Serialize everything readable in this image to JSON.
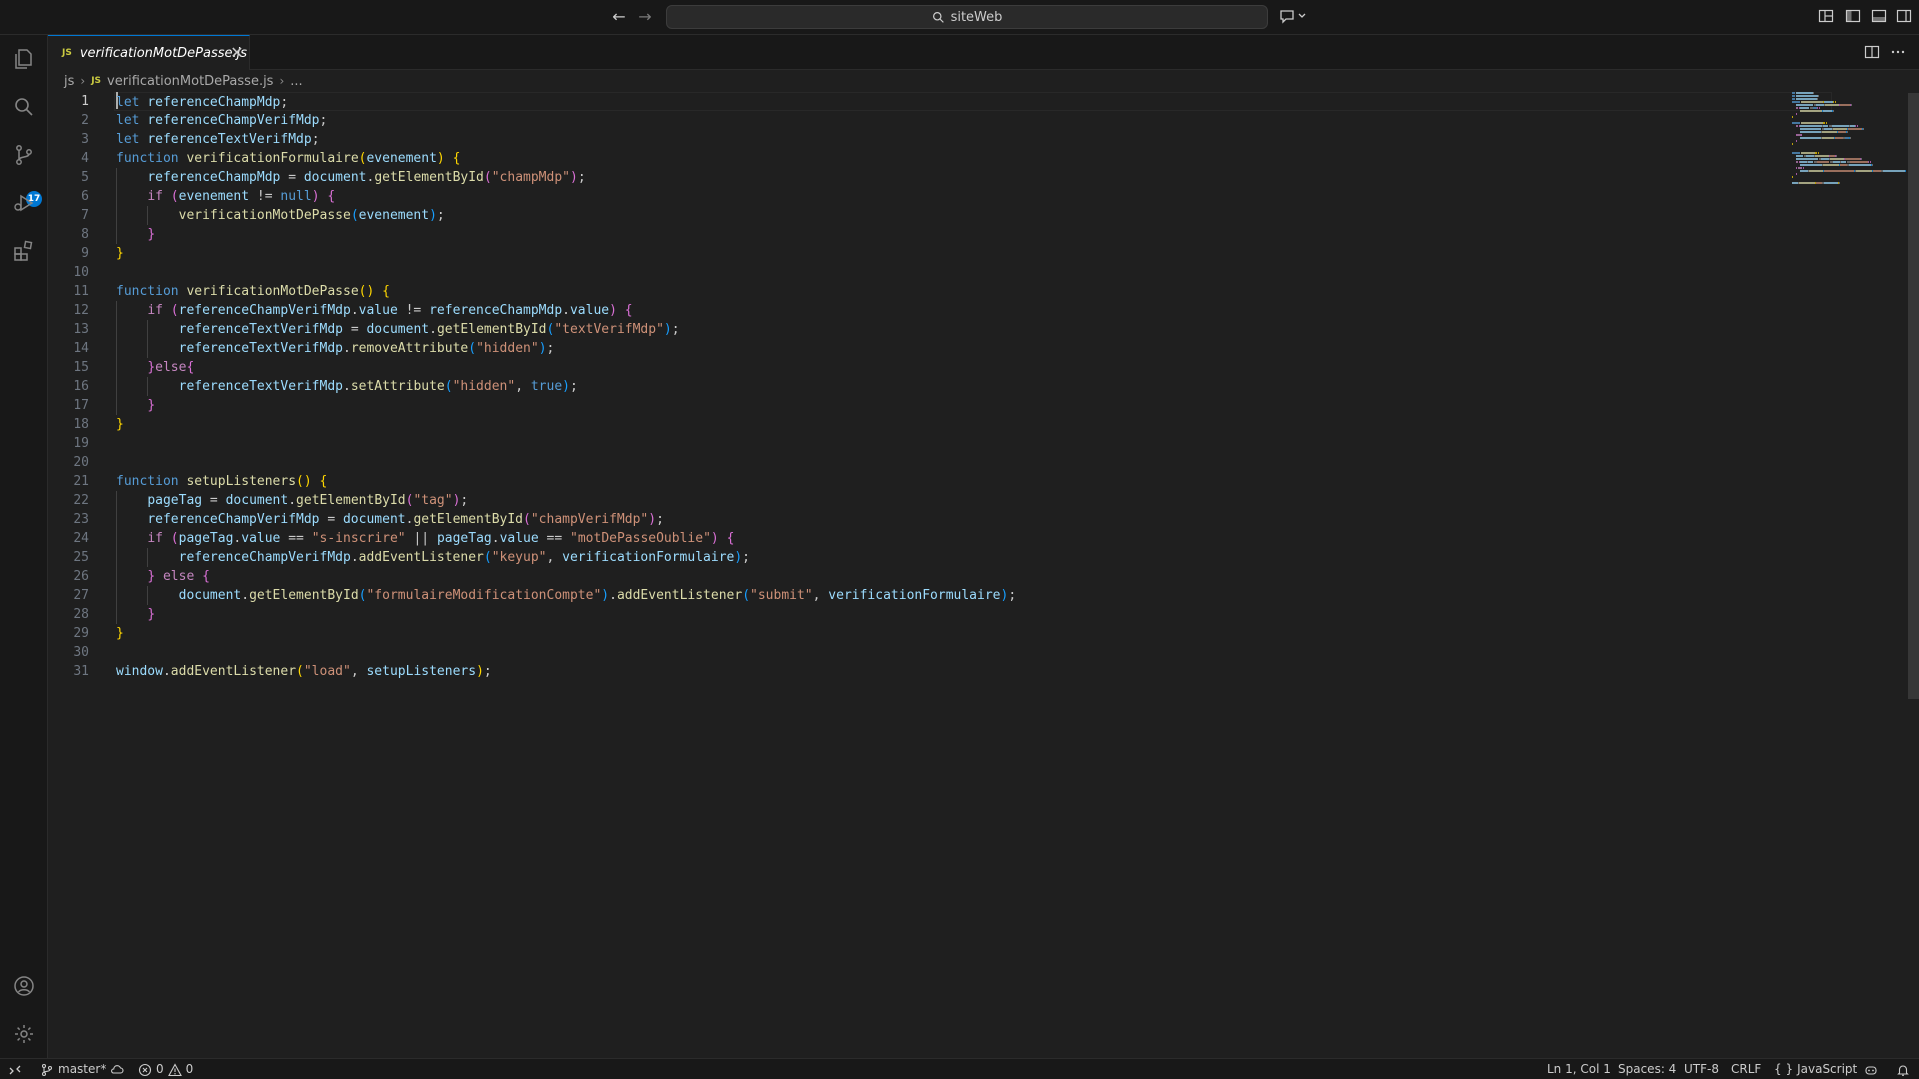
{
  "window": {
    "search_text": "siteWeb",
    "nav_back": "←",
    "nav_forward": "→"
  },
  "tab": {
    "icon_text": "JS",
    "label": "verificationMotDePasse.js",
    "close": "✕"
  },
  "breadcrumb": {
    "folder": "js",
    "file_icon_text": "JS",
    "file": "verificationMotDePasse.js",
    "symbol": "..."
  },
  "activity": {
    "scm_badge": "17"
  },
  "editor": {
    "line_numbers": [
      "1",
      "2",
      "3",
      "4",
      "5",
      "6",
      "7",
      "8",
      "9",
      "10",
      "11",
      "12",
      "13",
      "14",
      "15",
      "16",
      "17",
      "18",
      "19",
      "20",
      "21",
      "22",
      "23",
      "24",
      "25",
      "26",
      "27",
      "28",
      "29",
      "30",
      "31"
    ],
    "active_line": 1,
    "lines": [
      [
        [
          "kw",
          "let"
        ],
        [
          "pn",
          " "
        ],
        [
          "var",
          "referenceChampMdp"
        ],
        [
          "pn",
          ";"
        ]
      ],
      [
        [
          "kw",
          "let"
        ],
        [
          "pn",
          " "
        ],
        [
          "var",
          "referenceChampVerifMdp"
        ],
        [
          "pn",
          ";"
        ]
      ],
      [
        [
          "kw",
          "let"
        ],
        [
          "pn",
          " "
        ],
        [
          "var",
          "referenceTextVerifMdp"
        ],
        [
          "pn",
          ";"
        ]
      ],
      [
        [
          "kw",
          "function"
        ],
        [
          "pn",
          " "
        ],
        [
          "fn",
          "verificationFormulaire"
        ],
        [
          "b1",
          "("
        ],
        [
          "var",
          "evenement"
        ],
        [
          "b1",
          ")"
        ],
        [
          "pn",
          " "
        ],
        [
          "b1",
          "{"
        ]
      ],
      [
        [
          "pn",
          "    "
        ],
        [
          "var",
          "referenceChampMdp"
        ],
        [
          "pn",
          " = "
        ],
        [
          "var",
          "document"
        ],
        [
          "pn",
          "."
        ],
        [
          "fn",
          "getElementById"
        ],
        [
          "b2",
          "("
        ],
        [
          "str",
          "\"champMdp\""
        ],
        [
          "b2",
          ")"
        ],
        [
          "pn",
          ";"
        ]
      ],
      [
        [
          "pn",
          "    "
        ],
        [
          "ctrl",
          "if"
        ],
        [
          "pn",
          " "
        ],
        [
          "b2",
          "("
        ],
        [
          "var",
          "evenement"
        ],
        [
          "pn",
          " != "
        ],
        [
          "kw",
          "null"
        ],
        [
          "b2",
          ")"
        ],
        [
          "pn",
          " "
        ],
        [
          "b2",
          "{"
        ]
      ],
      [
        [
          "pn",
          "        "
        ],
        [
          "fn",
          "verificationMotDePasse"
        ],
        [
          "b3",
          "("
        ],
        [
          "var",
          "evenement"
        ],
        [
          "b3",
          ")"
        ],
        [
          "pn",
          ";"
        ]
      ],
      [
        [
          "pn",
          "    "
        ],
        [
          "b2",
          "}"
        ]
      ],
      [
        [
          "b1",
          "}"
        ]
      ],
      [],
      [
        [
          "kw",
          "function"
        ],
        [
          "pn",
          " "
        ],
        [
          "fn",
          "verificationMotDePasse"
        ],
        [
          "b1",
          "()"
        ],
        [
          "pn",
          " "
        ],
        [
          "b1",
          "{"
        ]
      ],
      [
        [
          "pn",
          "    "
        ],
        [
          "ctrl",
          "if"
        ],
        [
          "pn",
          " "
        ],
        [
          "b2",
          "("
        ],
        [
          "var",
          "referenceChampVerifMdp"
        ],
        [
          "pn",
          "."
        ],
        [
          "var",
          "value"
        ],
        [
          "pn",
          " != "
        ],
        [
          "var",
          "referenceChampMdp"
        ],
        [
          "pn",
          "."
        ],
        [
          "var",
          "value"
        ],
        [
          "b2",
          ")"
        ],
        [
          "pn",
          " "
        ],
        [
          "b2",
          "{"
        ]
      ],
      [
        [
          "pn",
          "        "
        ],
        [
          "var",
          "referenceTextVerifMdp"
        ],
        [
          "pn",
          " = "
        ],
        [
          "var",
          "document"
        ],
        [
          "pn",
          "."
        ],
        [
          "fn",
          "getElementById"
        ],
        [
          "b3",
          "("
        ],
        [
          "str",
          "\"textVerifMdp\""
        ],
        [
          "b3",
          ")"
        ],
        [
          "pn",
          ";"
        ]
      ],
      [
        [
          "pn",
          "        "
        ],
        [
          "var",
          "referenceTextVerifMdp"
        ],
        [
          "pn",
          "."
        ],
        [
          "fn",
          "removeAttribute"
        ],
        [
          "b3",
          "("
        ],
        [
          "str",
          "\"hidden\""
        ],
        [
          "b3",
          ")"
        ],
        [
          "pn",
          ";"
        ]
      ],
      [
        [
          "pn",
          "    "
        ],
        [
          "b2",
          "}"
        ],
        [
          "ctrl",
          "else"
        ],
        [
          "b2",
          "{"
        ]
      ],
      [
        [
          "pn",
          "        "
        ],
        [
          "var",
          "referenceTextVerifMdp"
        ],
        [
          "pn",
          "."
        ],
        [
          "fn",
          "setAttribute"
        ],
        [
          "b3",
          "("
        ],
        [
          "str",
          "\"hidden\""
        ],
        [
          "pn",
          ", "
        ],
        [
          "kw",
          "true"
        ],
        [
          "b3",
          ")"
        ],
        [
          "pn",
          ";"
        ]
      ],
      [
        [
          "pn",
          "    "
        ],
        [
          "b2",
          "}"
        ]
      ],
      [
        [
          "b1",
          "}"
        ]
      ],
      [],
      [],
      [
        [
          "kw",
          "function"
        ],
        [
          "pn",
          " "
        ],
        [
          "fn",
          "setupListeners"
        ],
        [
          "b1",
          "()"
        ],
        [
          "pn",
          " "
        ],
        [
          "b1",
          "{"
        ]
      ],
      [
        [
          "pn",
          "    "
        ],
        [
          "var",
          "pageTag"
        ],
        [
          "pn",
          " = "
        ],
        [
          "var",
          "document"
        ],
        [
          "pn",
          "."
        ],
        [
          "fn",
          "getElementById"
        ],
        [
          "b2",
          "("
        ],
        [
          "str",
          "\"tag\""
        ],
        [
          "b2",
          ")"
        ],
        [
          "pn",
          ";"
        ]
      ],
      [
        [
          "pn",
          "    "
        ],
        [
          "var",
          "referenceChampVerifMdp"
        ],
        [
          "pn",
          " = "
        ],
        [
          "var",
          "document"
        ],
        [
          "pn",
          "."
        ],
        [
          "fn",
          "getElementById"
        ],
        [
          "b2",
          "("
        ],
        [
          "str",
          "\"champVerifMdp\""
        ],
        [
          "b2",
          ")"
        ],
        [
          "pn",
          ";"
        ]
      ],
      [
        [
          "pn",
          "    "
        ],
        [
          "ctrl",
          "if"
        ],
        [
          "pn",
          " "
        ],
        [
          "b2",
          "("
        ],
        [
          "var",
          "pageTag"
        ],
        [
          "pn",
          "."
        ],
        [
          "var",
          "value"
        ],
        [
          "pn",
          " == "
        ],
        [
          "str",
          "\"s-inscrire\""
        ],
        [
          "pn",
          " || "
        ],
        [
          "var",
          "pageTag"
        ],
        [
          "pn",
          "."
        ],
        [
          "var",
          "value"
        ],
        [
          "pn",
          " == "
        ],
        [
          "str",
          "\"motDePasseOublie\""
        ],
        [
          "b2",
          ")"
        ],
        [
          "pn",
          " "
        ],
        [
          "b2",
          "{"
        ]
      ],
      [
        [
          "pn",
          "        "
        ],
        [
          "var",
          "referenceChampVerifMdp"
        ],
        [
          "pn",
          "."
        ],
        [
          "fn",
          "addEventListener"
        ],
        [
          "b3",
          "("
        ],
        [
          "str",
          "\"keyup\""
        ],
        [
          "pn",
          ", "
        ],
        [
          "var",
          "verificationFormulaire"
        ],
        [
          "b3",
          ")"
        ],
        [
          "pn",
          ";"
        ]
      ],
      [
        [
          "pn",
          "    "
        ],
        [
          "b2",
          "}"
        ],
        [
          "pn",
          " "
        ],
        [
          "ctrl",
          "else"
        ],
        [
          "pn",
          " "
        ],
        [
          "b2",
          "{"
        ]
      ],
      [
        [
          "pn",
          "        "
        ],
        [
          "var",
          "document"
        ],
        [
          "pn",
          "."
        ],
        [
          "fn",
          "getElementById"
        ],
        [
          "b3",
          "("
        ],
        [
          "str",
          "\"formulaireModificationCompte\""
        ],
        [
          "b3",
          ")"
        ],
        [
          "pn",
          "."
        ],
        [
          "fn",
          "addEventListener"
        ],
        [
          "b3",
          "("
        ],
        [
          "str",
          "\"submit\""
        ],
        [
          "pn",
          ", "
        ],
        [
          "var",
          "verificationFormulaire"
        ],
        [
          "b3",
          ")"
        ],
        [
          "pn",
          ";"
        ]
      ],
      [
        [
          "pn",
          "    "
        ],
        [
          "b2",
          "}"
        ]
      ],
      [
        [
          "b1",
          "}"
        ]
      ],
      [],
      [
        [
          "var",
          "window"
        ],
        [
          "pn",
          "."
        ],
        [
          "fn",
          "addEventListener"
        ],
        [
          "b1",
          "("
        ],
        [
          "str",
          "\"load\""
        ],
        [
          "pn",
          ", "
        ],
        [
          "var",
          "setupListeners"
        ],
        [
          "b1",
          ")"
        ],
        [
          "pn",
          ";"
        ]
      ]
    ]
  },
  "status": {
    "branch": "master*",
    "errors": "0",
    "warnings": "0",
    "position": "Ln 1, Col 1",
    "spaces": "Spaces: 4",
    "encoding": "UTF-8",
    "eol": "CRLF",
    "language_braces": "{ }",
    "language": "JavaScript"
  },
  "colors": {
    "accent": "#0078d4",
    "keyword": "#569cd6",
    "control": "#c586c0",
    "variable": "#9cdcfe",
    "function": "#dcdcaa",
    "string": "#ce9178"
  }
}
